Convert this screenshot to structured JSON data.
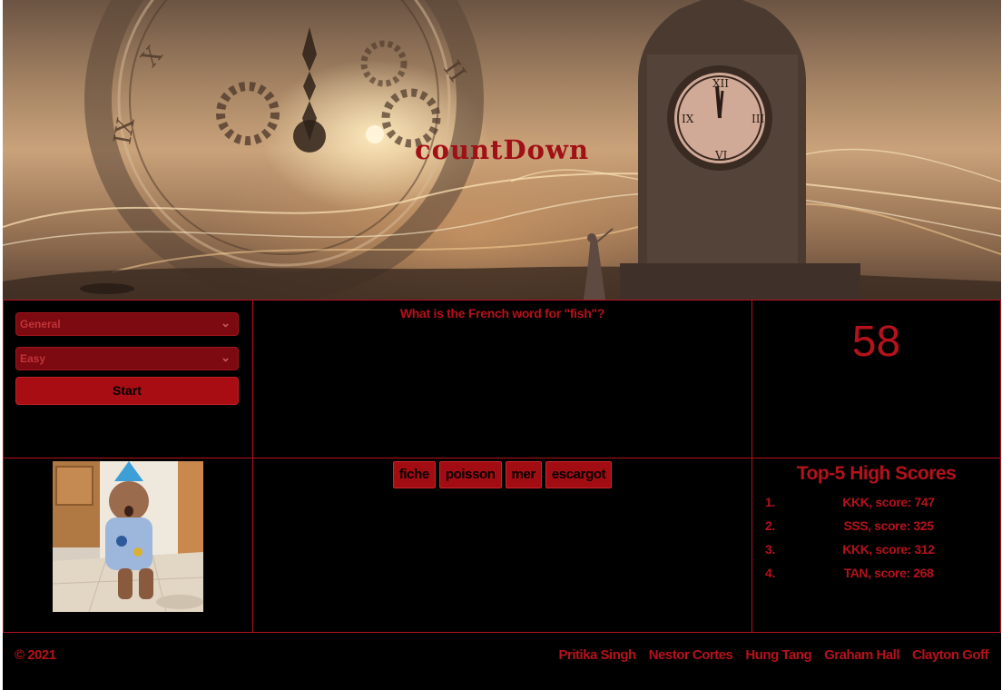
{
  "hero": {
    "title": "countDown"
  },
  "controls": {
    "category_value": "General",
    "difficulty_value": "Easy",
    "start_label": "Start"
  },
  "question": {
    "text": "What is the French word for \"fish\"?"
  },
  "timer": {
    "value": "58"
  },
  "answers": [
    "fiche",
    "poisson",
    "mer",
    "escargot"
  ],
  "high_scores": {
    "title": "Top-5 High Scores",
    "entries": [
      {
        "rank": "1.",
        "text": "KKK, score: 747"
      },
      {
        "rank": "2.",
        "text": "SSS, score: 325"
      },
      {
        "rank": "3.",
        "text": "KKK, score: 312"
      },
      {
        "rank": "4.",
        "text": "TAN, score: 268"
      }
    ]
  },
  "footer": {
    "copyright": "© 2021",
    "credits": [
      "Pritika Singh",
      "Nestor Cortes",
      "Hung Tang",
      "Graham Hall",
      "Clayton Goff"
    ]
  },
  "colors": {
    "accent": "#b5121b",
    "button": "#a90d14",
    "background": "#000000"
  }
}
